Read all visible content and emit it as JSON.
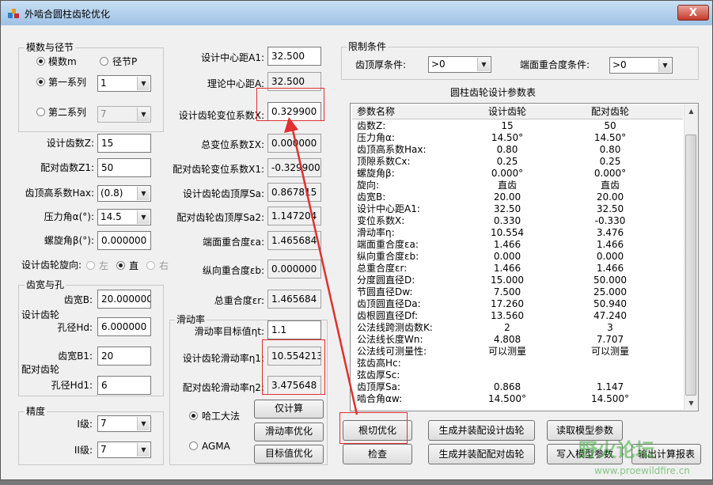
{
  "window": {
    "title": "外啮合圆柱齿轮优化",
    "close_label": "X"
  },
  "modulus_group": {
    "title": "模数与径节",
    "radio_m": "模数m",
    "radio_p": "径节P",
    "radio_series1": "第一系列",
    "series1_value": "1",
    "radio_series2": "第二系列",
    "series2_value": "7"
  },
  "left": {
    "z_label": "设计齿数Z:",
    "z_value": "15",
    "z1_label": "配对齿数Z1:",
    "z1_value": "50",
    "hax_label": "齿顶高系数Hax:",
    "hax_value": "(0.8)",
    "alpha_label": "压力角α(°):",
    "alpha_value": "14.5",
    "beta_label": "螺旋角β(°):",
    "beta_value": "0.000000",
    "dir_label": "设计齿轮旋向:",
    "dir_left": "左",
    "dir_straight": "直",
    "dir_right": "右"
  },
  "width_group": {
    "title": "齿宽与孔",
    "design_label": "设计齿轮",
    "b_label": "齿宽B:",
    "b_value": "20.000000",
    "hd_label": "孔径Hd:",
    "hd_value": "6.000000",
    "mate_label": "配对齿轮",
    "b1_label": "齿宽B1:",
    "b1_value": "20",
    "hd1_label": "孔径Hd1:",
    "hd1_value": "6"
  },
  "precision_group": {
    "title": "精度",
    "level1_label": "I级:",
    "level1_value": "7",
    "level2_label": "II级:",
    "level2_value": "7"
  },
  "middle": {
    "a1_label": "设计中心距A1:",
    "a1_value": "32.500",
    "a_label": "理论中心距A:",
    "a_value": "32.500",
    "x_label": "设计齿轮变位系数X:",
    "x_value": "0.329900",
    "sx_label": "总变位系数ΣX:",
    "sx_value": "0.000000",
    "x1_label": "配对齿轮变位系数X1:",
    "x1_value": "-0.329900",
    "sa_label": "设计齿轮齿顶厚Sa:",
    "sa_value": "0.867815",
    "sa2_label": "配对齿轮齿顶厚Sa2:",
    "sa2_value": "1.147204",
    "ea_label": "端面重合度εa:",
    "ea_value": "1.465684",
    "eb_label": "纵向重合度εb:",
    "eb_value": "0.000000",
    "er_label": "总重合度εr:",
    "er_value": "1.465684"
  },
  "slip_group": {
    "title": "滑动率",
    "target_label": "滑动率目标值ηt:",
    "target_value": "1.1",
    "eta1_label": "设计齿轮滑动率η1:",
    "eta1_value": "10.554213",
    "eta2_label": "配对齿轮滑动率η2:",
    "eta2_value": "3.475648",
    "radio_harbin": "哈工大法",
    "radio_agma": "AGMA",
    "btn_calc": "仅计算",
    "btn_slip_opt": "滑动率优化",
    "btn_target_opt": "目标值优化"
  },
  "limits": {
    "title": "限制条件",
    "tip_label": "齿顶厚条件:",
    "tip_value": ">0",
    "contact_label": "端面重合度条件:",
    "contact_value": ">0"
  },
  "table": {
    "title": "圆柱齿轮设计参数表",
    "headers": [
      "参数名称",
      "设计齿轮",
      "配对齿轮"
    ],
    "rows": [
      [
        "齿数Z:",
        "15",
        "50"
      ],
      [
        "压力角α:",
        "14.50°",
        "14.50°"
      ],
      [
        "齿顶高系数Hax:",
        "0.80",
        "0.80"
      ],
      [
        "顶隙系数Cx:",
        "0.25",
        "0.25"
      ],
      [
        "螺旋角β:",
        "0.000°",
        "0.000°"
      ],
      [
        "旋向:",
        "直齿",
        "直齿"
      ],
      [
        "齿宽B:",
        "20.00",
        "20.00"
      ],
      [
        "设计中心距A1:",
        "32.50",
        "32.50"
      ],
      [
        "变位系数X:",
        "0.330",
        "-0.330"
      ],
      [
        "滑动率η:",
        "10.554",
        "3.476"
      ],
      [
        "端面重合度εa:",
        "1.466",
        "1.466"
      ],
      [
        "纵向重合度εb:",
        "0.000",
        "0.000"
      ],
      [
        "总重合度εr:",
        "1.466",
        "1.466"
      ],
      [
        "分度圆直径D:",
        "15.000",
        "50.000"
      ],
      [
        "节圆直径Dw:",
        "7.500",
        "25.000"
      ],
      [
        "齿顶圆直径Da:",
        "17.260",
        "50.940"
      ],
      [
        "齿根圆直径Df:",
        "13.560",
        "47.240"
      ],
      [
        "公法线跨测齿数K:",
        "2",
        "3"
      ],
      [
        "公法线长度Wn:",
        "4.808",
        "7.707"
      ],
      [
        "公法线可测量性:",
        "可以测量",
        "可以测量"
      ],
      [
        "弦齿高Hc:",
        "",
        ""
      ],
      [
        "弦齿厚Sc:",
        "",
        ""
      ],
      [
        "齿顶厚Sa:",
        "0.868",
        "1.147"
      ],
      [
        "啮合角αw:",
        "14.500°",
        "14.500°"
      ]
    ]
  },
  "actions": {
    "root_opt": "根切优化",
    "gen_design": "生成并装配设计齿轮",
    "read_params": "读取模型参数",
    "check": "检查",
    "gen_mate": "生成并装配配对齿轮",
    "write_params": "写入模型参数",
    "output_report": "输出计算报表"
  },
  "watermark": {
    "text": "野火论坛",
    "url": "www.proewildfire.cn"
  },
  "colors": {
    "annotation": "#e03030",
    "titlebar": "#b8d3ee"
  }
}
